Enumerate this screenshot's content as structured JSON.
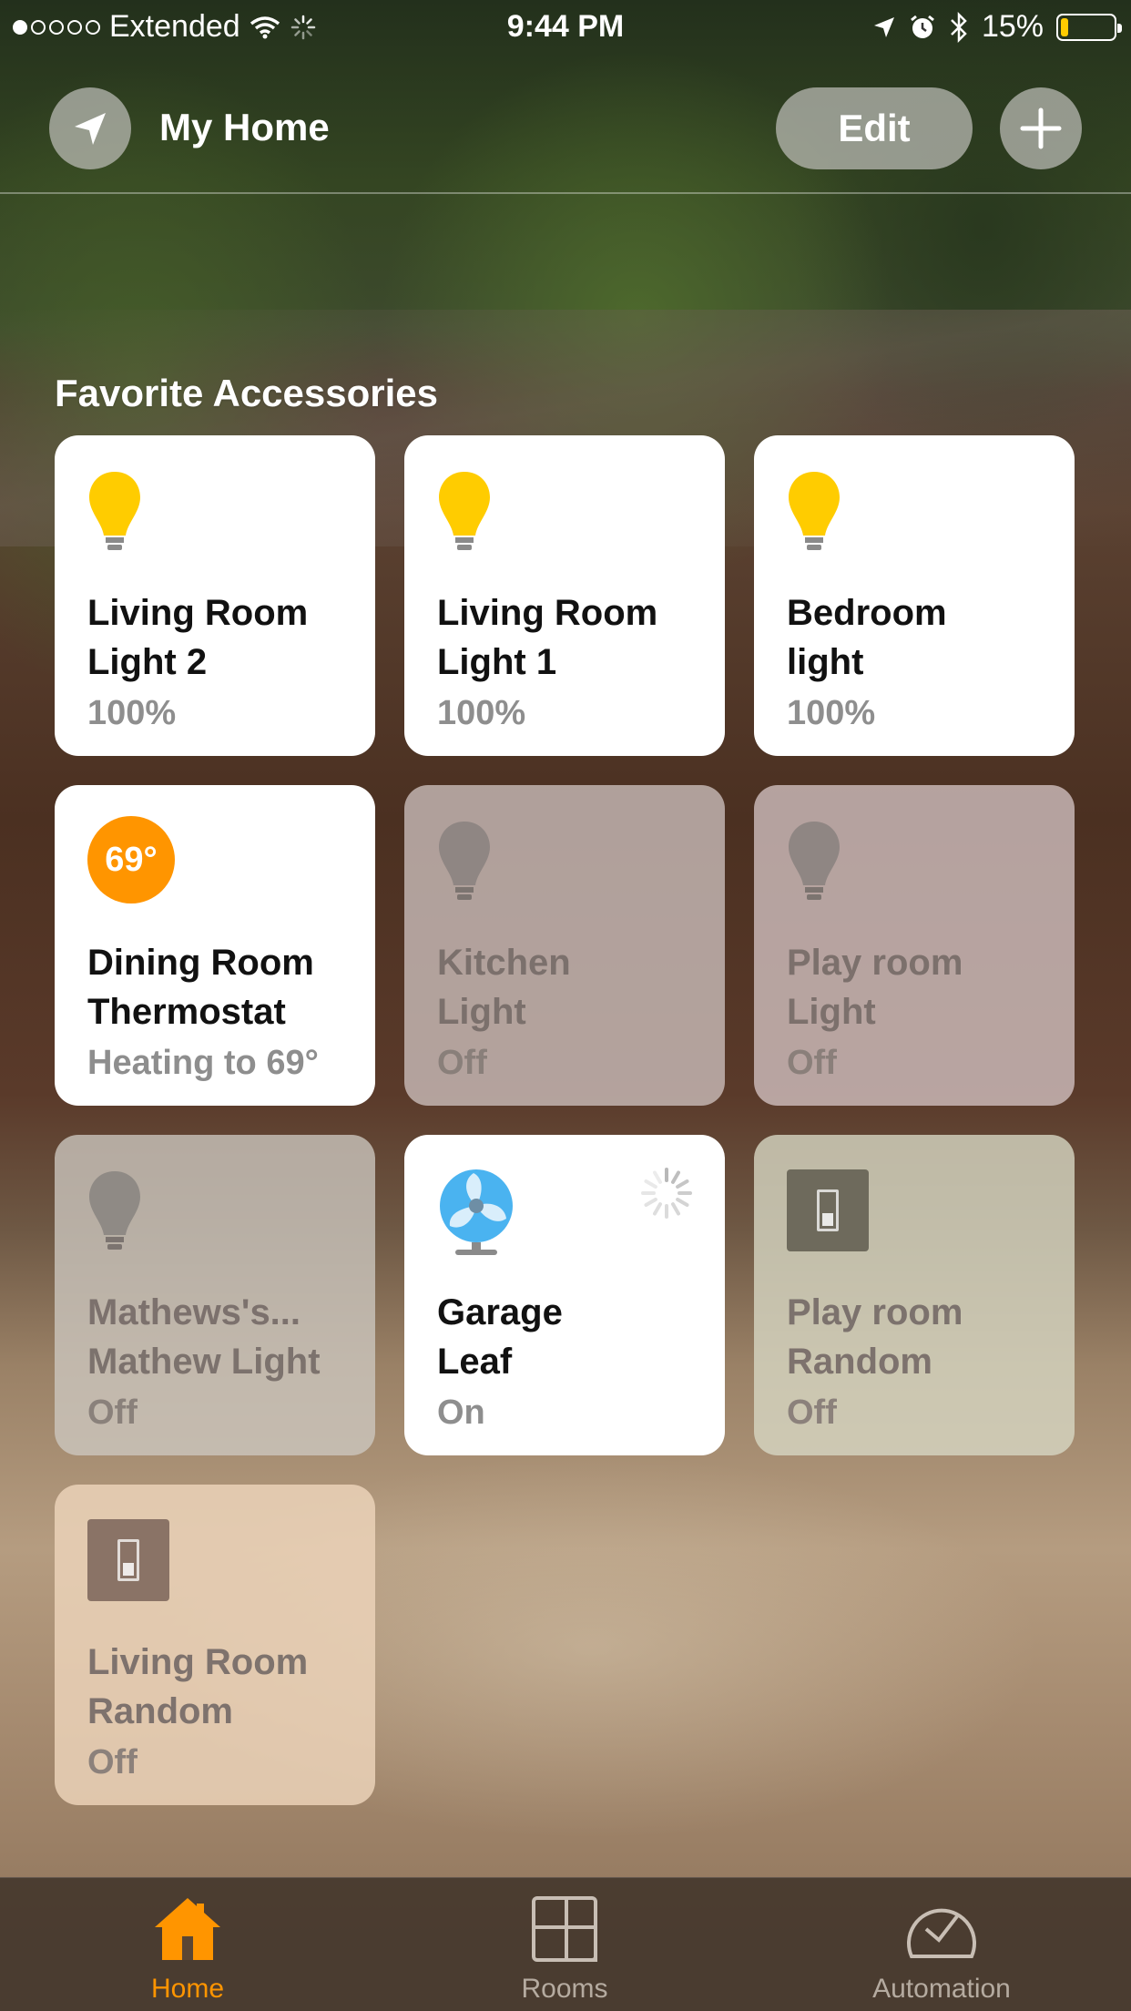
{
  "status_bar": {
    "carrier": "Extended",
    "time": "9:44 PM",
    "battery_percent": "15%",
    "battery_level": 0.15,
    "icons": [
      "signal-dots-icon",
      "wifi-icon",
      "activity-spinner-icon",
      "location-arrow-icon",
      "alarm-icon",
      "bluetooth-icon",
      "battery-icon"
    ]
  },
  "nav": {
    "title": "My Home",
    "edit_label": "Edit",
    "icons": [
      "location-arrow-icon",
      "plus-icon"
    ]
  },
  "section": {
    "title": "Favorite Accessories"
  },
  "tiles": [
    {
      "name_line1": "Living Room",
      "name_line2": "Light 2",
      "state": "100%",
      "on": true,
      "icon": "lightbulb-icon"
    },
    {
      "name_line1": "Living Room",
      "name_line2": "Light 1",
      "state": "100%",
      "on": true,
      "icon": "lightbulb-icon"
    },
    {
      "name_line1": "Bedroom",
      "name_line2": "light",
      "state": "100%",
      "on": true,
      "icon": "lightbulb-icon"
    },
    {
      "name_line1": "Dining Room",
      "name_line2": "Thermostat",
      "state": "Heating to 69°",
      "badge": "69°",
      "on": true,
      "icon": "thermostat-icon"
    },
    {
      "name_line1": "Kitchen",
      "name_line2": "Light",
      "state": "Off",
      "on": false,
      "icon": "lightbulb-icon"
    },
    {
      "name_line1": "Play room",
      "name_line2": "Light",
      "state": "Off",
      "on": false,
      "icon": "lightbulb-icon"
    },
    {
      "name_line1": "Mathews's...",
      "name_line2": "Mathew Light",
      "state": "Off",
      "on": false,
      "icon": "lightbulb-icon"
    },
    {
      "name_line1": "Garage",
      "name_line2": "Leaf",
      "state": "On",
      "on": true,
      "icon": "fan-icon"
    },
    {
      "name_line1": "Play room",
      "name_line2": "Random",
      "state": "Off",
      "on": false,
      "icon": "switch-icon"
    },
    {
      "name_line1": "Living Room",
      "name_line2": "Random",
      "state": "Off",
      "on": false,
      "icon": "switch-icon"
    }
  ],
  "tabbar": {
    "home_label": "Home",
    "rooms_label": "Rooms",
    "automation_label": "Automation",
    "active": "Home"
  },
  "colors": {
    "accent": "#ff9500",
    "bulb_on": "#ffcc00",
    "bulb_off": "#8a8480"
  }
}
